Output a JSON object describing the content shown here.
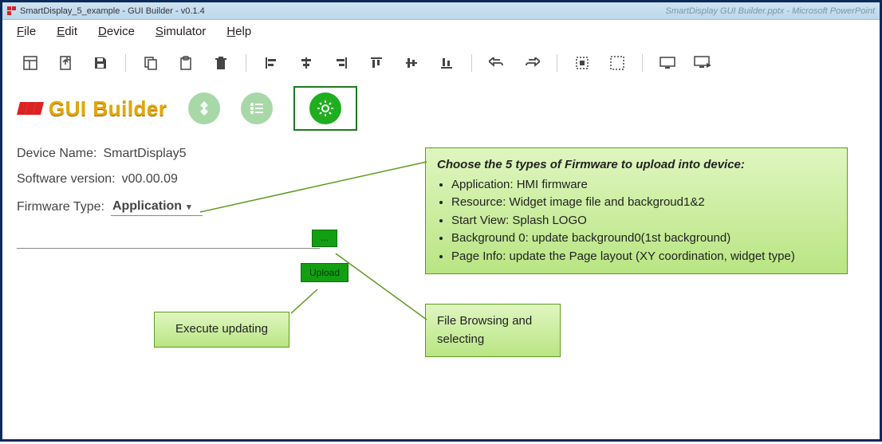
{
  "window": {
    "title": "SmartDisplay_5_example - GUI Builder - v0.1.4",
    "bg_tab": "SmartDisplay GUI Builder.pptx - Microsoft PowerPoint"
  },
  "menu": {
    "file": "File",
    "edit": "Edit",
    "device": "Device",
    "simulator": "Simulator",
    "help": "Help"
  },
  "brand": {
    "text": "GUI Builder"
  },
  "info": {
    "device_name_label": "Device Name:",
    "device_name_value": "SmartDisplay5",
    "software_version_label": "Software version:",
    "software_version_value": "v00.00.09",
    "firmware_type_label": "Firmware Type:",
    "firmware_type_value": "Application"
  },
  "buttons": {
    "browse": "...",
    "upload": "Upload"
  },
  "callouts": {
    "big_title": "Choose the 5 types of Firmware to upload into device:",
    "big_items": [
      "Application: HMI firmware",
      "Resource: Widget image file and backgroud1&2",
      "Start View: Splash LOGO",
      "Background 0: update background0(1st background)",
      "Page Info: update the Page layout (XY coordination, widget type)"
    ],
    "mid": "File Browsing and selecting",
    "small": "Execute updating"
  }
}
